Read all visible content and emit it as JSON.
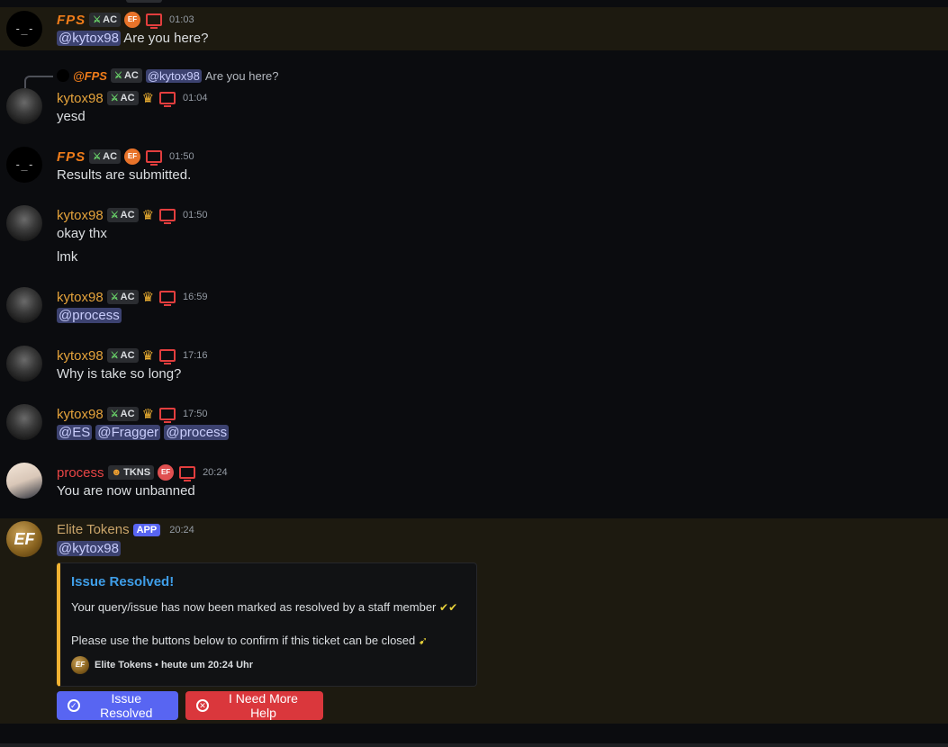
{
  "colors": {
    "background": "#0b0c0f",
    "highlight": "#1d1a10",
    "mention": "#3c4270",
    "blurple": "#5865f2",
    "danger": "#da373c",
    "embed_accent": "#f0b232",
    "embed_title": "#3f9ee8"
  },
  "messages": [
    {
      "author": "FPS",
      "badge": "AC",
      "extra_badge": "EF",
      "time": "01:03",
      "mention": "@kytox98",
      "text": "Are you here?"
    },
    {
      "author": "kytox98",
      "badge": "AC",
      "time": "01:04",
      "text": "yesd",
      "reply": {
        "author": "@FPS",
        "badge": "AC",
        "mention": "@kytox98",
        "text": "Are you here?"
      }
    },
    {
      "author": "FPS",
      "badge": "AC",
      "extra_badge": "EF",
      "time": "01:50",
      "text": "Results are submitted."
    },
    {
      "author": "kytox98",
      "badge": "AC",
      "time": "01:50",
      "text": "okay thx",
      "text2": "lmk"
    },
    {
      "author": "kytox98",
      "badge": "AC",
      "time": "16:59",
      "mention": "@process"
    },
    {
      "author": "kytox98",
      "badge": "AC",
      "time": "17:16",
      "text": "Why is take so long?"
    },
    {
      "author": "kytox98",
      "badge": "AC",
      "time": "17:50",
      "mentions": [
        "@ES",
        "@Fragger",
        "@process"
      ]
    },
    {
      "author": "process",
      "badge": "TKNS",
      "extra_badge": "EF",
      "time": "20:24",
      "text": "You are now unbanned"
    },
    {
      "author": "Elite Tokens",
      "badge": "APP",
      "time": "20:24",
      "mention": "@kytox98",
      "avatar_text": "EF",
      "embed": {
        "title": "Issue Resolved!",
        "desc1": "Your query/issue has now been marked as resolved by a staff member",
        "desc2": "Please use the buttons below to confirm if this ticket can be closed",
        "footer_avatar": "EF",
        "footer": "Elite Tokens • heute um 20:24 Uhr"
      },
      "buttons": {
        "resolved": "Issue Resolved",
        "more_help": "I Need More Help"
      }
    }
  ]
}
